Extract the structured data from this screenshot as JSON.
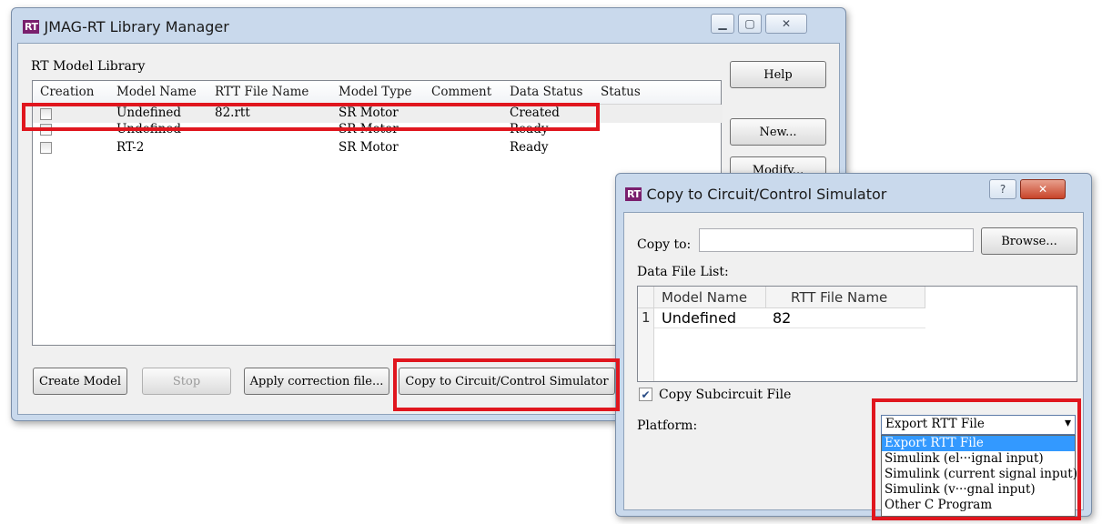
{
  "main_window": {
    "title": "JMAG-RT Library Manager",
    "logo": "RT",
    "group_label": "RT Model Library",
    "columns": [
      "Creation",
      "Model Name",
      "RTT File Name",
      "Model Type",
      "Comment",
      "Data Status",
      "Status"
    ],
    "rows": [
      {
        "model_name": "Undefined",
        "rtt_file": "82.rtt",
        "model_type": "SR Motor",
        "comment": "",
        "data_status": "Created",
        "status": ""
      },
      {
        "model_name": "Undefined",
        "rtt_file": "",
        "model_type": "SR Motor",
        "comment": "",
        "data_status": "Ready",
        "status": ""
      },
      {
        "model_name": "RT-2",
        "rtt_file": "",
        "model_type": "SR Motor",
        "comment": "",
        "data_status": "Ready",
        "status": ""
      }
    ],
    "buttons": {
      "help": "Help",
      "new": "New...",
      "modify": "Modify...",
      "create_model": "Create Model",
      "stop": "Stop",
      "apply_correction": "Apply correction file...",
      "copy_to_simulator": "Copy to Circuit/Control Simulator"
    },
    "controls": {
      "minimize": "▁",
      "maximize": "▢",
      "close": "✕"
    }
  },
  "dialog": {
    "title": "Copy to Circuit/Control Simulator",
    "logo": "RT",
    "copy_to_label": "Copy to:",
    "copy_to_value": "",
    "browse_button": "Browse...",
    "data_file_list_label": "Data File List:",
    "columns": [
      "Model Name",
      "RTT File Name"
    ],
    "rows": [
      {
        "index": "1",
        "model_name": "Undefined",
        "rtt_file": "82"
      }
    ],
    "copy_subcircuit_label": "Copy Subcircuit File",
    "copy_subcircuit_checked": true,
    "checkmark": "✔",
    "platform_label": "Platform:",
    "platform_selected": "Export RTT File",
    "platform_options": [
      "Export RTT File",
      "Simulink (el···ignal input)",
      "Simulink (current signal input)",
      "Simulink (v···gnal input)",
      "Other C Program"
    ],
    "help_icon": "?",
    "close_icon": "✕",
    "dropdown_arrow": "▾"
  },
  "colors": {
    "highlight": "#e0161e",
    "selection": "#3399ff",
    "logo": "#7a1f6d"
  }
}
